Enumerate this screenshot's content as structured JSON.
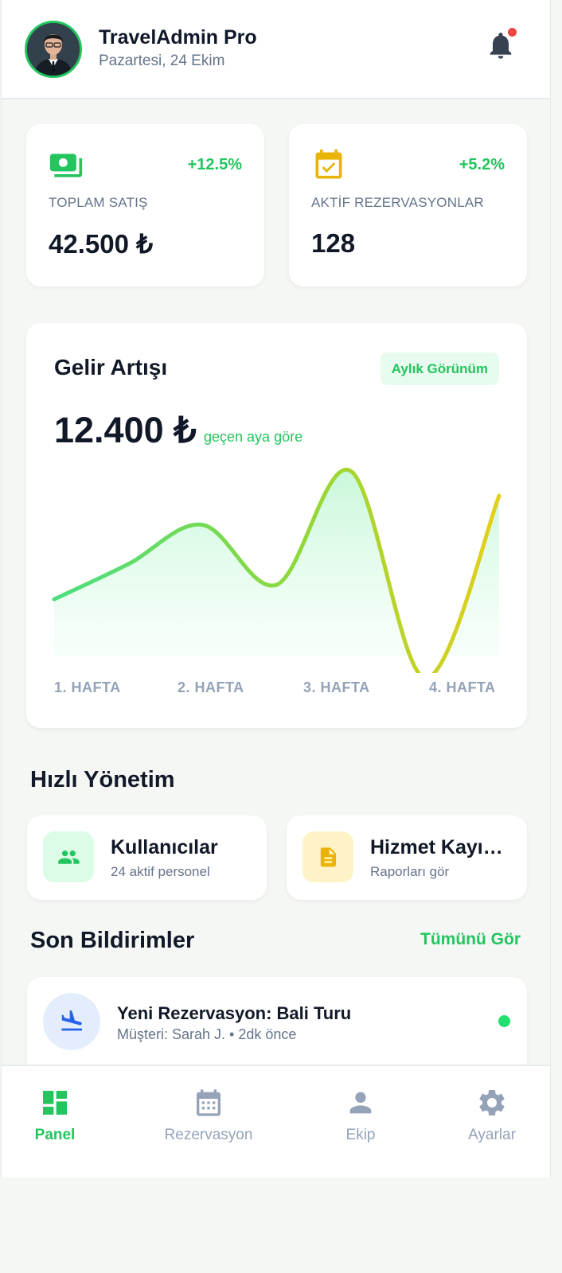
{
  "header": {
    "title": "TravelAdmin Pro",
    "date": "Pazartesi, 24 Ekim",
    "has_unread_notifications": true
  },
  "stats": [
    {
      "icon": "money-icon",
      "change": "+12.5%",
      "label": "TOPLAM SATIŞ",
      "value": "42.500 ₺"
    },
    {
      "icon": "calendar-check-icon",
      "change": "+5.2%",
      "label": "AKTİF REZERVASYONLAR",
      "value": "128"
    }
  ],
  "revenue": {
    "title": "Gelir Artışı",
    "view_toggle": "Aylık Görünüm",
    "amount": "12.400 ₺",
    "comparison": "geçen aya göre"
  },
  "chart_data": {
    "type": "area",
    "x": [
      "1. HAFTA",
      "",
      "2. HAFTA",
      "",
      "3. HAFTA",
      "",
      "4. HAFTA"
    ],
    "categories": [
      "1. HAFTA",
      "2. HAFTA",
      "3. HAFTA",
      "4. HAFTA"
    ],
    "y": [
      0.38,
      0.55,
      0.74,
      0.45,
      1.0,
      0.0,
      0.88
    ],
    "colors": {
      "start": "#4ade80",
      "end": "#e5cf1a"
    },
    "grid": false,
    "legend": "none"
  },
  "quick": {
    "title": "Hızlı Yönetim",
    "items": [
      {
        "icon": "users-icon",
        "title": "Kullanıcılar",
        "subtitle": "24 aktif personel",
        "color": "#22c55e",
        "bg": "#dcfce7"
      },
      {
        "icon": "document-icon",
        "title": "Hizmet Kayıtları",
        "subtitle": "Raporları gör",
        "color": "#eab308",
        "bg": "#fef3c7"
      }
    ]
  },
  "notifications": {
    "title": "Son Bildirimler",
    "see_all": "Tümünü Gör",
    "items": [
      {
        "icon": "plane-landing-icon",
        "title": "Yeni Rezervasyon: Bali Turu",
        "meta": "Müşteri: Sarah J. • 2dk önce",
        "unread": true
      }
    ]
  },
  "tabs": [
    {
      "icon": "dashboard-icon",
      "label": "Panel",
      "active": true
    },
    {
      "icon": "calendar-icon",
      "label": "Rezervasyon",
      "active": false
    },
    {
      "icon": "person-icon",
      "label": "Ekip",
      "active": false
    },
    {
      "icon": "gear-icon",
      "label": "Ayarlar",
      "active": false
    }
  ],
  "colors": {
    "accent": "#22c55e",
    "warning": "#eab308",
    "text": "#111827",
    "muted": "#64748b"
  }
}
